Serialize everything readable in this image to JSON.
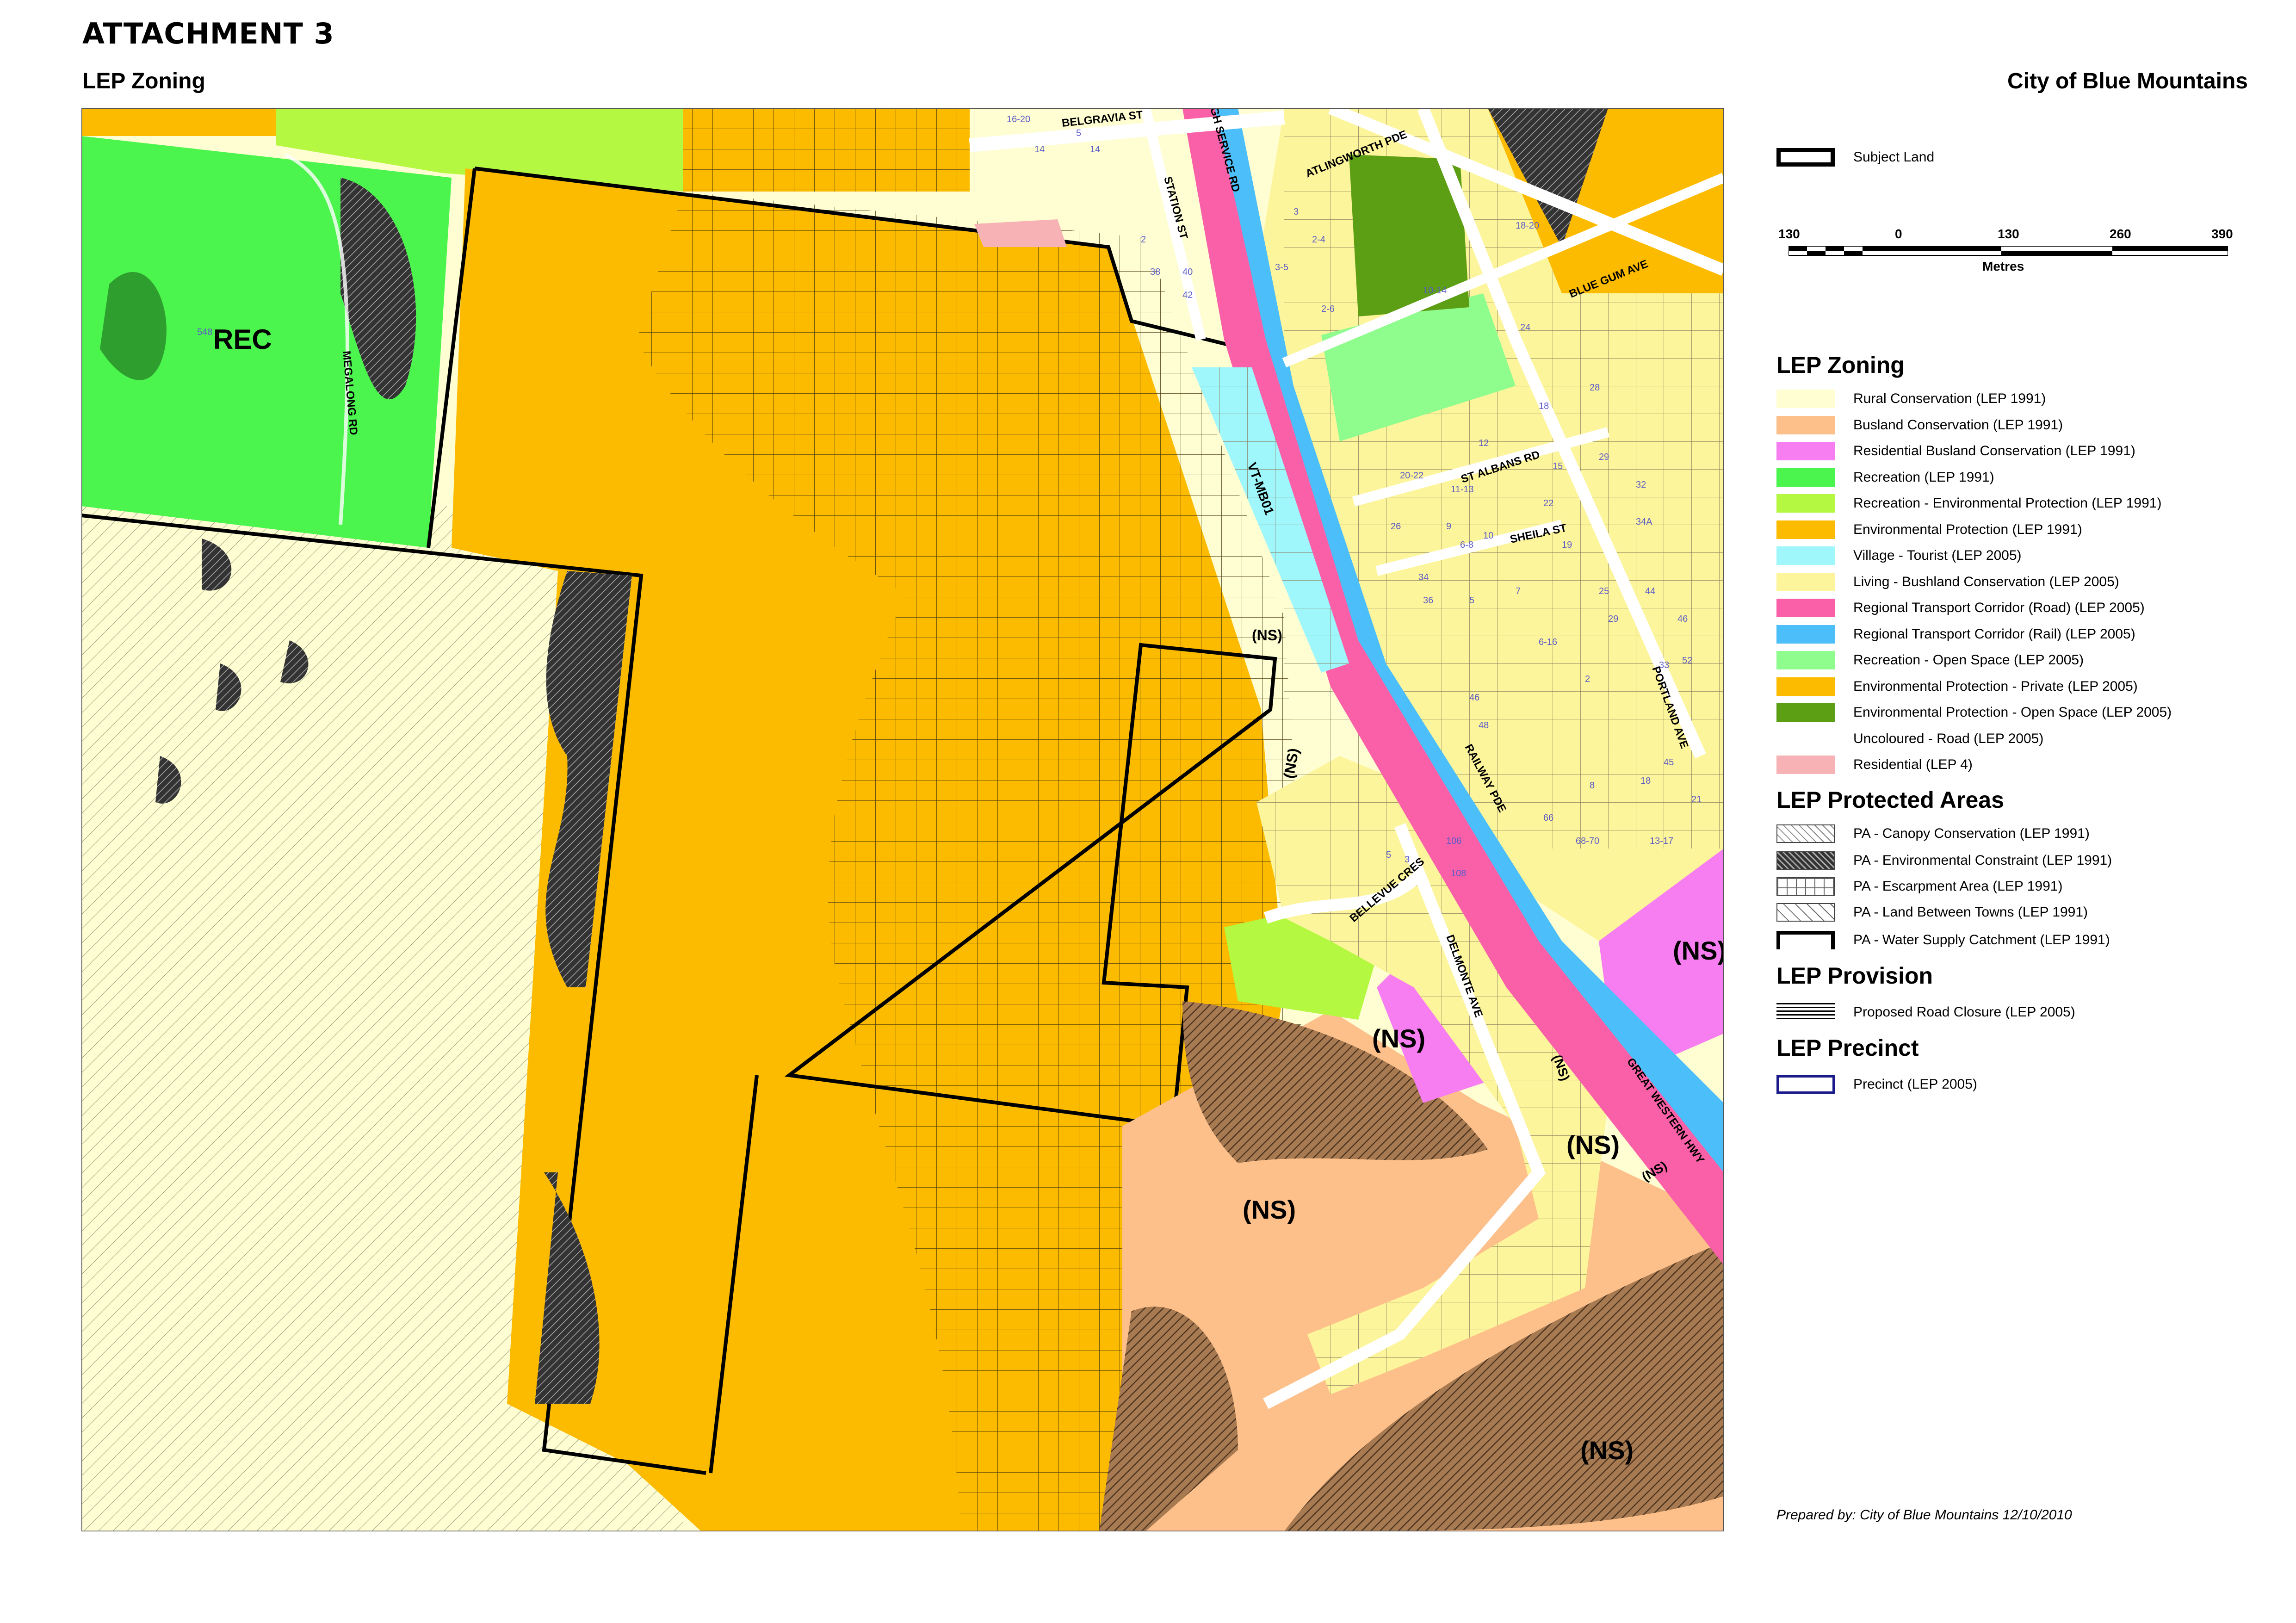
{
  "header": {
    "title": "ATTACHMENT 3",
    "subtitle": "LEP Zoning",
    "organisation": "City of Blue Mountains"
  },
  "map": {
    "zone_labels": [
      "REC",
      "(NS)",
      "(NS)",
      "(NS)",
      "(NS)",
      "(NS)",
      "(NS)",
      "(NS)",
      "(NS)",
      "(NS)",
      "VT-MB01"
    ],
    "street_labels": [
      "BELGRAVIA ST",
      "STATION ST",
      "GH SERVICE RD",
      "ATLINGWORTH PDE",
      "BLUE GUM AVE",
      "MEGALONG RD",
      "ST ALBANS RD",
      "SHEILA ST",
      "PORTLAND AVE",
      "RAILWAY PDE",
      "BELLEVUE CRES",
      "DELMONTE AVE",
      "GREAT WESTERN HWY"
    ],
    "lot_numbers": [
      "16-20",
      "14",
      "14",
      "5",
      "2",
      "38",
      "40",
      "42",
      "3",
      "2-4",
      "3-5",
      "2-6",
      "10-14",
      "18-20",
      "24",
      "28",
      "18",
      "12",
      "15",
      "29",
      "32",
      "20-22",
      "11-13",
      "22",
      "26",
      "9",
      "6-8",
      "10",
      "19",
      "34A",
      "34",
      "36",
      "5",
      "7",
      "25",
      "44",
      "29",
      "6-16",
      "46",
      "52",
      "33",
      "2",
      "46",
      "48",
      "45",
      "18",
      "8",
      "66",
      "5",
      "3",
      "106",
      "108",
      "68-70",
      "13-17",
      "21",
      "548"
    ]
  },
  "legend": {
    "subject_land": {
      "label": "Subject Land"
    },
    "scale": {
      "ticks": [
        "130",
        "0",
        "130",
        "260",
        "390"
      ],
      "unit": "Metres"
    },
    "zoning": {
      "title": "LEP Zoning",
      "items": [
        {
          "label": "Rural Conservation (LEP 1991)",
          "color": "#fefed2"
        },
        {
          "label": "Busland Conservation (LEP 1991)",
          "color": "#fdc08a"
        },
        {
          "label": "Residential Busland Conservation (LEP 1991)",
          "color": "#f77ef0"
        },
        {
          "label": "Recreation (LEP 1991)",
          "color": "#4cf54e"
        },
        {
          "label": "Recreation - Environmental Protection (LEP 1991)",
          "color": "#b5f842"
        },
        {
          "label": "Environmental Protection (LEP 1991)",
          "color": "#fdbb00"
        },
        {
          "label": "Village - Tourist (LEP 2005)",
          "color": "#9ff7fb"
        },
        {
          "label": "Living - Bushland Conservation (LEP 2005)",
          "color": "#fdf59b"
        },
        {
          "label": "Regional Transport Corridor (Road) (LEP 2005)",
          "color": "#f960a8"
        },
        {
          "label": "Regional Transport Corridor (Rail) (LEP 2005)",
          "color": "#4cbefa"
        },
        {
          "label": "Recreation - Open Space (LEP 2005)",
          "color": "#8ffc8e"
        },
        {
          "label": "Environmental Protection - Private (LEP 2005)",
          "color": "#fdbb00"
        },
        {
          "label": "Environmental Protection - Open Space (LEP 2005)",
          "color": "#5c9e14"
        },
        {
          "label": "Uncoloured - Road (LEP 2005)",
          "color": "#ffffff"
        },
        {
          "label": "Residential (LEP 4)",
          "color": "#f7b2b6"
        }
      ]
    },
    "protected": {
      "title": "LEP Protected Areas",
      "items": [
        {
          "label": "PA - Canopy Conservation (LEP 1991)",
          "pattern": "hatch-light"
        },
        {
          "label": "PA - Environmental Constraint (LEP 1991)",
          "pattern": "hatch-dark"
        },
        {
          "label": "PA - Escarpment Area (LEP 1991)",
          "pattern": "grid"
        },
        {
          "label": "PA - Land Between Towns (LEP 1991)",
          "pattern": "hatch-wide"
        },
        {
          "label": "PA - Water Supply Catchment (LEP 1991)",
          "pattern": "thick-outline"
        }
      ]
    },
    "provision": {
      "title": "LEP Provision",
      "items": [
        {
          "label": "Proposed Road Closure (LEP 2005)",
          "pattern": "horizontal-lines"
        }
      ]
    },
    "precinct": {
      "title": "LEP Precinct",
      "items": [
        {
          "label": "Precinct (LEP 2005)",
          "color": "#1a1a8a"
        }
      ]
    }
  },
  "footer": {
    "prepared_by": "Prepared by: City of Blue Mountains 12/10/2010"
  }
}
